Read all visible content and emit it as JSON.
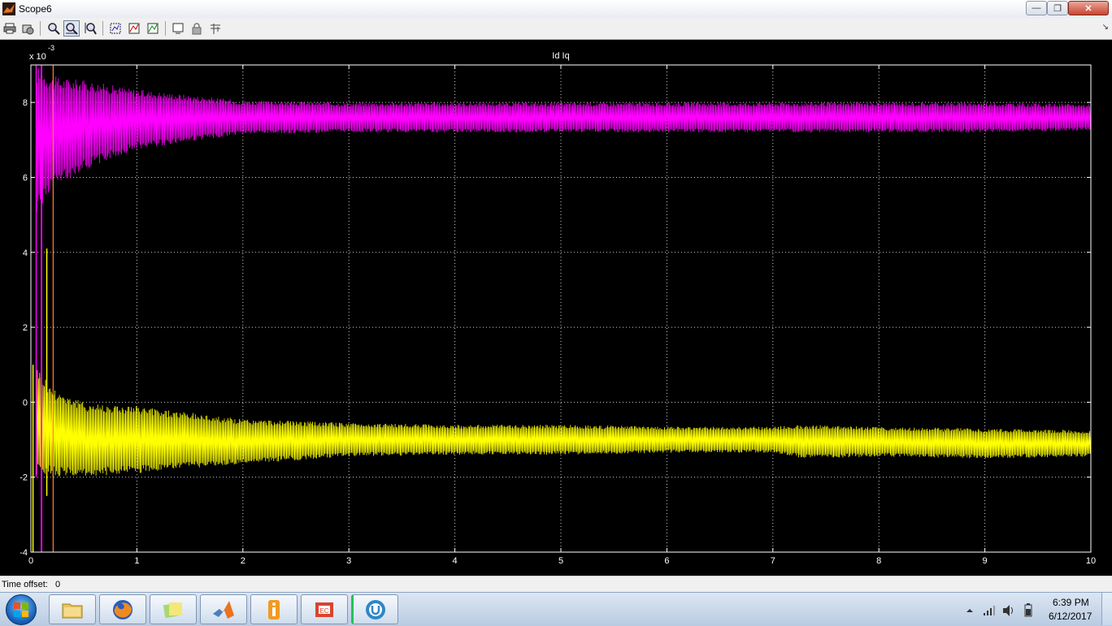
{
  "window": {
    "title": "Scope6"
  },
  "window_controls": {
    "minimize": "—",
    "maximize": "❐",
    "close": "✕"
  },
  "toolbar": {
    "items": [
      "print-icon",
      "params-icon",
      "zoom-icon",
      "zoom-x-icon",
      "zoom-y-icon",
      "autoscale-icon",
      "save-axes-icon",
      "restore-axes-icon",
      "floating-scope-icon",
      "lock-icon",
      "signal-selector-icon"
    ],
    "corner": "↘"
  },
  "chart_data": {
    "type": "line",
    "title": "Id  Iq",
    "xlabel": "",
    "ylabel": "",
    "y_exponent": "x 10",
    "y_exponent_power": "-3",
    "xlim": [
      0,
      10
    ],
    "ylim": [
      -4,
      9
    ],
    "x_ticks": [
      "0",
      "1",
      "2",
      "3",
      "4",
      "5",
      "6",
      "7",
      "8",
      "9",
      "10"
    ],
    "y_ticks": [
      "-4",
      "-2",
      "0",
      "2",
      "4",
      "6",
      "8"
    ],
    "grid": true,
    "series": [
      {
        "color": "#ff00ff",
        "x": [
          0.05,
          0.2,
          0.5,
          1,
          2,
          3,
          4,
          5,
          6,
          7,
          8,
          9,
          10
        ],
        "mean": [
          7.0,
          7.2,
          7.4,
          7.55,
          7.6,
          7.6,
          7.6,
          7.6,
          7.6,
          7.6,
          7.6,
          7.6,
          7.6
        ],
        "amp": [
          2.0,
          1.5,
          1.2,
          0.8,
          0.45,
          0.4,
          0.4,
          0.4,
          0.4,
          0.4,
          0.4,
          0.4,
          0.35
        ]
      },
      {
        "color": "#ffff00",
        "x": [
          0.05,
          0.2,
          0.5,
          1,
          2,
          3,
          4,
          5,
          6,
          7,
          7.3,
          8,
          9,
          10
        ],
        "mean": [
          -0.5,
          -0.8,
          -1.0,
          -1.0,
          -1.05,
          -1.0,
          -1.0,
          -1.0,
          -1.0,
          -1.0,
          -1.05,
          -1.05,
          -1.1,
          -1.1
        ],
        "amp": [
          1.5,
          1.2,
          1.0,
          0.9,
          0.6,
          0.45,
          0.4,
          0.4,
          0.35,
          0.35,
          0.45,
          0.4,
          0.4,
          0.35
        ]
      }
    ]
  },
  "status": {
    "time_offset_label": "Time offset:",
    "time_offset_value": "0"
  },
  "taskbar": {
    "apps": [
      "folder-icon",
      "firefox-icon",
      "sticky-notes-icon",
      "matlab-icon",
      "info-app-icon",
      "presentation-icon",
      "uget-icon"
    ]
  },
  "tray": {
    "time": "6:39 PM",
    "date": "6/12/2017"
  }
}
